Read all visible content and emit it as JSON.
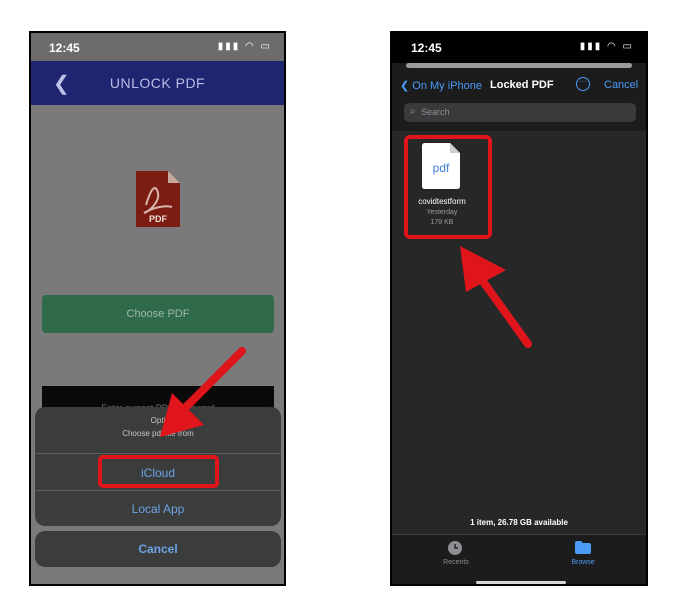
{
  "left": {
    "status": {
      "time": "12:45",
      "icons": "▮▮▮ ◠ ▭"
    },
    "header": {
      "title": "UNLOCK PDF",
      "back_glyph": "❮"
    },
    "file_icon_label": "PDF",
    "choose_pdf_label": "Choose PDF",
    "password_placeholder": "Enter current PDF password",
    "sheet": {
      "title": "Opti",
      "subtitle": "Choose pdf file from",
      "options": [
        "iCloud",
        "Local App"
      ],
      "cancel_label": "Cancel"
    }
  },
  "right": {
    "status": {
      "time": "12:45",
      "icons": "▮▮▮ ◠ ▭"
    },
    "nav": {
      "back_label": "On My iPhone",
      "title": "Locked PDF",
      "more_glyph": "···",
      "cancel_label": "Cancel"
    },
    "search": {
      "placeholder": "Search"
    },
    "file": {
      "icon_text": "pdf",
      "name": "covidtestform",
      "date": "Yesterday",
      "size": "179 KB"
    },
    "footer_info": "1 item, 26.78 GB available",
    "tabs": [
      {
        "label": "Recents",
        "icon": "clock-icon"
      },
      {
        "label": "Browse",
        "icon": "folder-icon"
      }
    ]
  },
  "colors": {
    "highlight": "#e0151b",
    "accent": "#4a9cf7",
    "header": "#1f2570",
    "button": "#2f6a4b"
  }
}
